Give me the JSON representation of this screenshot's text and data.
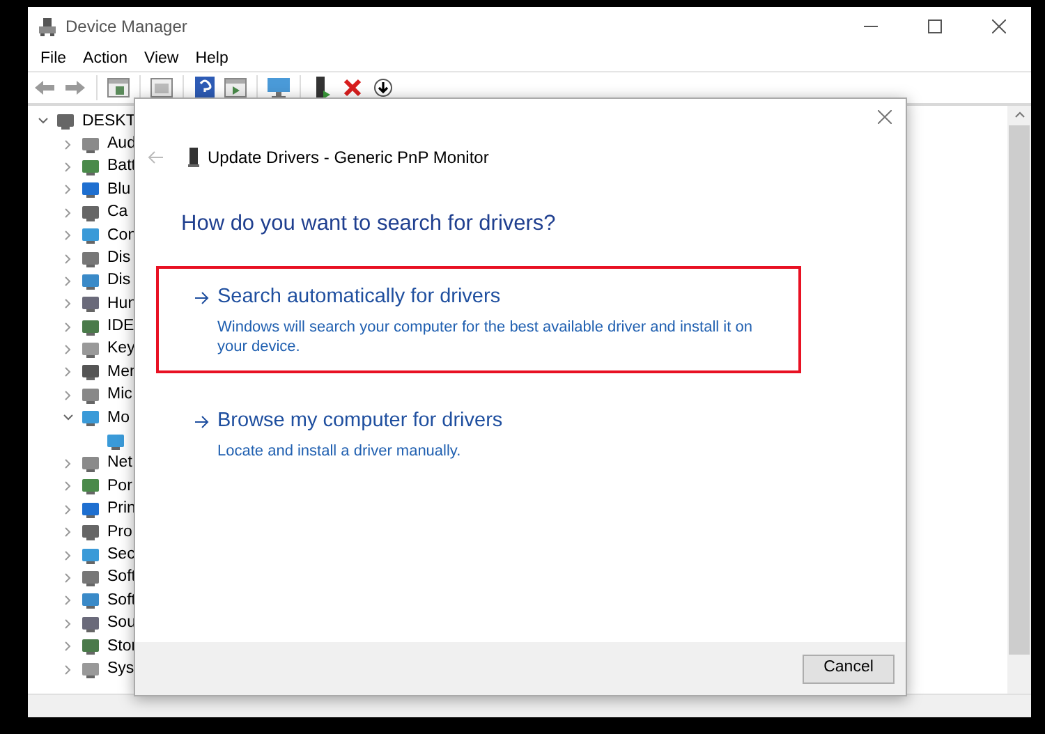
{
  "window": {
    "title": "Device Manager"
  },
  "menu": [
    "File",
    "Action",
    "View",
    "Help"
  ],
  "tree": {
    "label": "DESKT",
    "expanded": true,
    "children": [
      {
        "label": "Aud",
        "expanded": false
      },
      {
        "label": "Batt",
        "expanded": false
      },
      {
        "label": "Blu",
        "expanded": false
      },
      {
        "label": "Ca",
        "expanded": false
      },
      {
        "label": "Con",
        "expanded": false
      },
      {
        "label": "Dis",
        "expanded": false
      },
      {
        "label": "Dis",
        "expanded": false
      },
      {
        "label": "Hun",
        "expanded": false
      },
      {
        "label": "IDE",
        "expanded": false
      },
      {
        "label": "Key",
        "expanded": false
      },
      {
        "label": "Mer",
        "expanded": false
      },
      {
        "label": "Mic",
        "expanded": false
      },
      {
        "label": "Mo",
        "expanded": true,
        "children": [
          {
            "kind": "leaf"
          }
        ]
      },
      {
        "label": "Net",
        "expanded": false
      },
      {
        "label": "Por",
        "expanded": false
      },
      {
        "label": "Prin",
        "expanded": false
      },
      {
        "label": "Pro",
        "expanded": false
      },
      {
        "label": "Sec",
        "expanded": false
      },
      {
        "label": "Soft",
        "expanded": false
      },
      {
        "label": "Soft",
        "expanded": false
      },
      {
        "label": "Sou",
        "expanded": false
      },
      {
        "label": "Stor",
        "expanded": false
      },
      {
        "label": "Sys",
        "expanded": false
      }
    ]
  },
  "dialog": {
    "title": "Update Drivers - Generic PnP Monitor",
    "heading": "How do you want to search for drivers?",
    "options": [
      {
        "title": "Search automatically for drivers",
        "description": "Windows will search your computer for the best available driver and install it on your device.",
        "highlighted": true
      },
      {
        "title": "Browse my computer for drivers",
        "description": "Locate and install a driver manually.",
        "highlighted": false
      }
    ],
    "buttons": [
      "Cancel"
    ]
  }
}
